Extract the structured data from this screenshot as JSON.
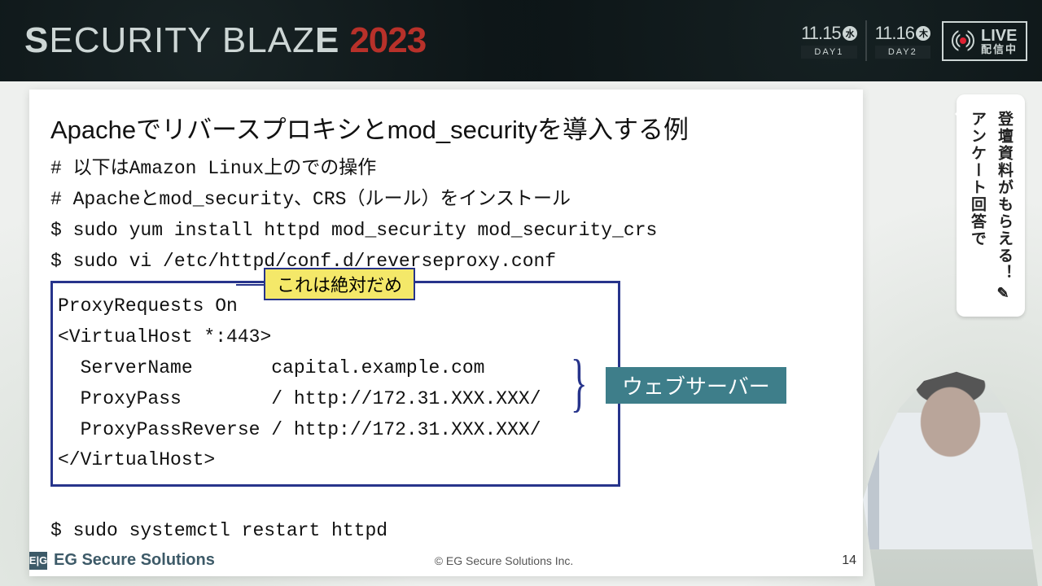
{
  "header": {
    "event_name_1": "S",
    "event_name_2": "ECURITY BLAZ",
    "event_name_3": "E",
    "event_year": "2023",
    "days": [
      {
        "date": "11.15",
        "dow": "水",
        "label": "DAY1"
      },
      {
        "date": "11.16",
        "dow": "木",
        "label": "DAY2"
      }
    ],
    "live_main": "LIVE",
    "live_sub": "配信中"
  },
  "survey": {
    "line1": "アンケート回答で",
    "line2": "登壇資料がもらえる！",
    "pencil": "✎"
  },
  "slide": {
    "title": "Apacheでリバースプロキシとmod_securityを導入する例",
    "commands": "# 以下はAmazon Linux上のでの操作\n# Apacheとmod_security、CRS（ルール）をインストール\n$ sudo yum install httpd mod_security mod_security_crs\n$ sudo vi /etc/httpd/conf.d/reverseproxy.conf",
    "conf": "ProxyRequests On\n<VirtualHost *:443>\n  ServerName       capital.example.com\n  ProxyPass        / http://172.31.XXX.XXX/\n  ProxyPassReverse / http://172.31.XXX.XXX/\n</VirtualHost>",
    "callout_bad": "これは絶対だめ",
    "callout_web": "ウェブサーバー",
    "restart": "$ sudo systemctl restart httpd",
    "footer_company_box": "E|G",
    "footer_company": "EG Secure Solutions",
    "copyright": "© EG Secure Solutions Inc.",
    "page": "14"
  }
}
